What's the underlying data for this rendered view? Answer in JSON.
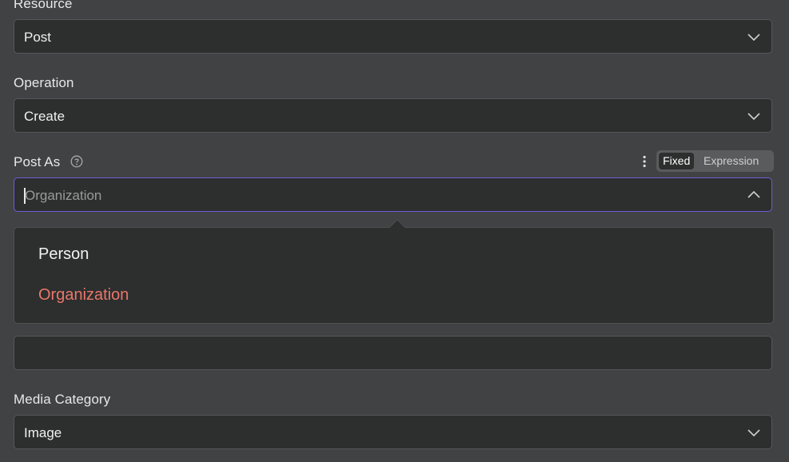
{
  "resource": {
    "label": "Resource",
    "value": "Post"
  },
  "operation": {
    "label": "Operation",
    "value": "Create"
  },
  "post_as": {
    "label": "Post As",
    "placeholder": "Organization",
    "mode_toggle": {
      "fixed": "Fixed",
      "expression": "Expression",
      "selected": "Fixed"
    },
    "options": [
      "Person",
      "Organization"
    ],
    "highlighted_option": "Organization"
  },
  "hidden_field": {
    "value": ""
  },
  "media_category": {
    "label": "Media Category",
    "value": "Image"
  },
  "colors": {
    "accent": "#6b5fd6",
    "highlight": "#e9776a",
    "background": "#414244",
    "field": "#2d2e2e"
  },
  "icons": [
    "chevron-down-icon",
    "chevron-up-icon",
    "help-icon",
    "kebab-menu-icon"
  ]
}
